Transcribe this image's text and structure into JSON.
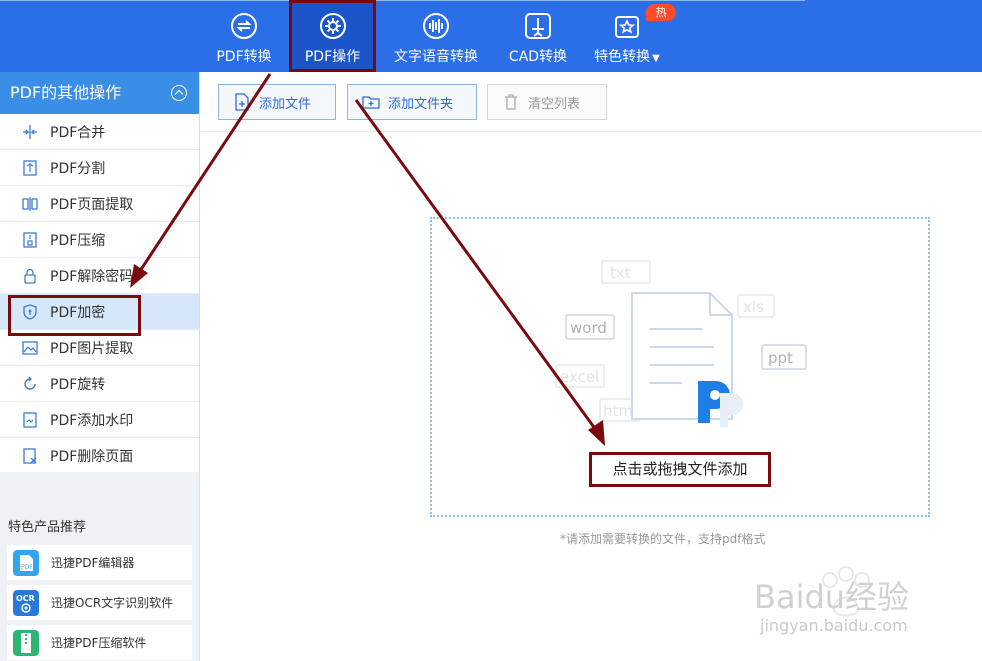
{
  "toolbar": {
    "tabs": [
      {
        "label": "PDF转换",
        "icon": "refresh-icon"
      },
      {
        "label": "PDF操作",
        "icon": "gear-icon"
      },
      {
        "label": "文字语音转换",
        "icon": "voice-wave-icon"
      },
      {
        "label": "CAD转换",
        "icon": "cad-icon"
      },
      {
        "label": "特色转换",
        "icon": "star-box-icon"
      }
    ],
    "hot_badge": "热",
    "active_tab": "PDF操作"
  },
  "sidebar": {
    "title": "PDF的其他操作",
    "items": [
      {
        "label": "PDF合并",
        "icon": "merge-icon"
      },
      {
        "label": "PDF分割",
        "icon": "split-icon"
      },
      {
        "label": "PDF页面提取",
        "icon": "page-extract-icon"
      },
      {
        "label": "PDF压缩",
        "icon": "compress-icon"
      },
      {
        "label": "PDF解除密码",
        "icon": "unlock-icon"
      },
      {
        "label": "PDF加密",
        "icon": "shield-icon"
      },
      {
        "label": "PDF图片提取",
        "icon": "image-icon"
      },
      {
        "label": "PDF旋转",
        "icon": "rotate-icon"
      },
      {
        "label": "PDF添加水印",
        "icon": "watermark-icon"
      },
      {
        "label": "PDF删除页面",
        "icon": "delete-page-icon"
      }
    ],
    "active_item": "PDF加密",
    "featured": {
      "title": "特色产品推荐",
      "products": [
        {
          "label": "迅捷PDF编辑器",
          "icon": "pdf-editor-icon"
        },
        {
          "label": "迅捷OCR文字识别软件",
          "icon": "ocr-icon"
        },
        {
          "label": "迅捷PDF压缩软件",
          "icon": "pdf-compress-app-icon"
        }
      ]
    }
  },
  "main": {
    "buttons": {
      "add_file": "添加文件",
      "add_folder": "添加文件夹",
      "clear_list": "清空列表"
    },
    "dropzone": {
      "cta": "点击或拖拽文件添加",
      "hint": "*请添加需要转换的文件，支持pdf格式",
      "format_tags": [
        "txt",
        "word",
        "xls",
        "ppt",
        "excel",
        "html"
      ]
    }
  },
  "watermark": {
    "text": "Baidu经验",
    "url": "jingyan.baidu.com"
  },
  "colors": {
    "toolbar_bg": "#2a6fe8",
    "active_tab_bg": "#1b55c9",
    "sidebar_header": "#3a8ee6",
    "annotation": "#7a0a0e",
    "hot_badge": "#ff4b2b",
    "dropzone_border": "#8fc3ea"
  }
}
